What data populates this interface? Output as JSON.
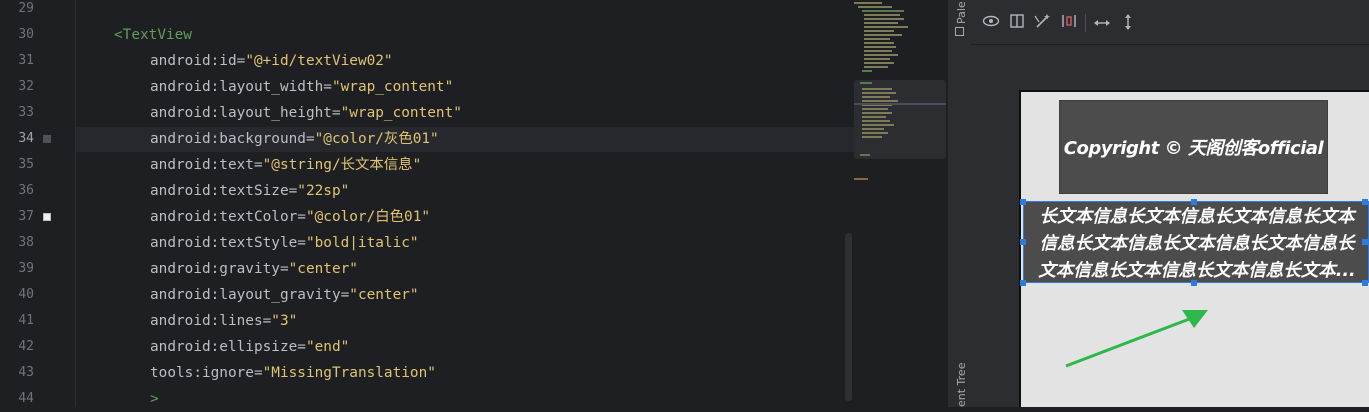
{
  "editor": {
    "lines": [
      {
        "num": "29",
        "parts": []
      },
      {
        "num": "30",
        "indent": 1,
        "parts": [
          {
            "t": "tag",
            "v": "<TextView"
          }
        ]
      },
      {
        "num": "31",
        "indent": 2,
        "parts": [
          {
            "t": "attr",
            "v": "android:id="
          },
          {
            "t": "val",
            "v": "\"@+id/textView02\""
          }
        ]
      },
      {
        "num": "32",
        "indent": 2,
        "parts": [
          {
            "t": "attr",
            "v": "android:layout_width="
          },
          {
            "t": "val",
            "v": "\"wrap_content\""
          }
        ]
      },
      {
        "num": "33",
        "indent": 2,
        "parts": [
          {
            "t": "attr",
            "v": "android:layout_height="
          },
          {
            "t": "val",
            "v": "\"wrap_content\""
          }
        ]
      },
      {
        "num": "34",
        "indent": 2,
        "current": true,
        "marker": "gray",
        "parts": [
          {
            "t": "attr",
            "v": "android:background="
          },
          {
            "t": "val",
            "v": "\"@color/灰色01\""
          }
        ]
      },
      {
        "num": "35",
        "indent": 2,
        "parts": [
          {
            "t": "attr",
            "v": "android:text="
          },
          {
            "t": "val",
            "v": "\"@string/长文本信息\""
          }
        ]
      },
      {
        "num": "36",
        "indent": 2,
        "parts": [
          {
            "t": "attr",
            "v": "android:textSize="
          },
          {
            "t": "val",
            "v": "\"22sp\""
          }
        ]
      },
      {
        "num": "37",
        "indent": 2,
        "marker": "white",
        "parts": [
          {
            "t": "attr",
            "v": "android:textColor="
          },
          {
            "t": "val",
            "v": "\"@color/白色01\""
          }
        ]
      },
      {
        "num": "38",
        "indent": 2,
        "parts": [
          {
            "t": "attr",
            "v": "android:textStyle="
          },
          {
            "t": "val",
            "v": "\"bold|italic\""
          }
        ]
      },
      {
        "num": "39",
        "indent": 2,
        "parts": [
          {
            "t": "attr",
            "v": "android:gravity="
          },
          {
            "t": "val",
            "v": "\"center\""
          }
        ]
      },
      {
        "num": "40",
        "indent": 2,
        "parts": [
          {
            "t": "attr",
            "v": "android:layout_gravity="
          },
          {
            "t": "val",
            "v": "\"center\""
          }
        ]
      },
      {
        "num": "41",
        "indent": 2,
        "parts": [
          {
            "t": "attr",
            "v": "android:lines="
          },
          {
            "t": "val",
            "v": "\"3\""
          }
        ]
      },
      {
        "num": "42",
        "indent": 2,
        "parts": [
          {
            "t": "attr",
            "v": "android:ellipsize="
          },
          {
            "t": "val",
            "v": "\"end\""
          }
        ]
      },
      {
        "num": "43",
        "indent": 2,
        "parts": [
          {
            "t": "attr",
            "v": "tools:ignore="
          },
          {
            "t": "val",
            "v": "\"MissingTranslation\""
          }
        ]
      },
      {
        "num": "44",
        "indent": 2,
        "parts": [
          {
            "t": "tag",
            "v": ">"
          }
        ]
      }
    ]
  },
  "side_strip": {
    "palette_label": "Pale",
    "tree_label": "ent Tree"
  },
  "design_toolbar": {
    "icons": [
      "eye-icon",
      "columns-icon",
      "magic-wand-icon",
      "constraint-icon",
      "horizontal-arrows-icon",
      "vertical-arrows-icon"
    ]
  },
  "preview": {
    "copyright_text": "Copyright © 天阁创客official",
    "long_text_lines": [
      "长文本信息长文本信息长文本信息长文本",
      "信息长文本信息长文本信息长文本信息长",
      "文本信息长文本信息长文本信息长文本..."
    ],
    "colors": {
      "view_background": "#4c4c4c",
      "text": "#ffffff",
      "selection": "#2f7ce0",
      "arrow": "#2db84a"
    }
  }
}
